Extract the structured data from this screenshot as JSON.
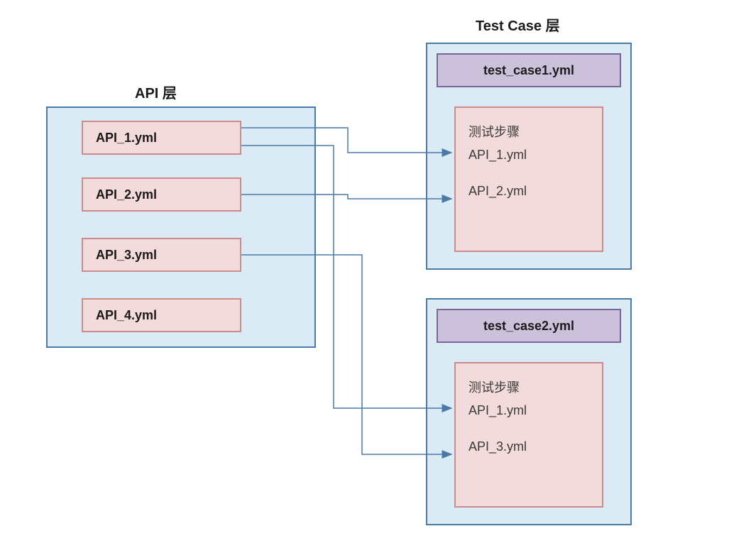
{
  "titles": {
    "api_layer": "API 层",
    "testcase_layer": "Test Case 层"
  },
  "api_layer": {
    "items": [
      {
        "label": "API_1.yml"
      },
      {
        "label": "API_2.yml"
      },
      {
        "label": "API_3.yml"
      },
      {
        "label": "API_4.yml"
      }
    ]
  },
  "testcases": [
    {
      "header": "test_case1.yml",
      "steps_title": "测试步骤",
      "steps": [
        "API_1.yml",
        "API_2.yml"
      ]
    },
    {
      "header": "test_case2.yml",
      "steps_title": "测试步骤",
      "steps": [
        "API_1.yml",
        "API_3.yml"
      ]
    }
  ],
  "colors": {
    "container_bg": "#dbebf5",
    "container_border": "#4a7aa8",
    "item_bg": "#f2dbda",
    "item_border": "#c98c8a",
    "header_bg": "#ccc1da",
    "header_border": "#7a6695"
  }
}
